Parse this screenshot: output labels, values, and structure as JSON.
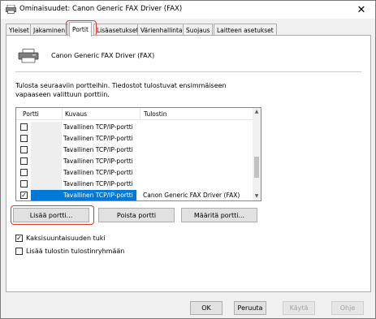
{
  "window": {
    "title": "Ominaisuudet: Canon Generic FAX Driver (FAX)",
    "close_glyph": "✕"
  },
  "tabs": [
    {
      "label": "Yleiset"
    },
    {
      "label": "Jakaminen"
    },
    {
      "label": "Portit",
      "active": true
    },
    {
      "label": "Lisäasetukset"
    },
    {
      "label": "Värienhallinta"
    },
    {
      "label": "Suojaus"
    },
    {
      "label": "Laitteen asetukset"
    }
  ],
  "printer": {
    "name": "Canon Generic FAX Driver (FAX)",
    "icon": "printer-icon"
  },
  "description": "Tulosta seuraaviin portteihin. Tiedostot tulostuvat ensimmäiseen vapaaseen valittuun porttiin.",
  "port_list": {
    "columns": [
      "Portti",
      "Kuvaus",
      "Tulostin"
    ],
    "rows": [
      {
        "checked": false,
        "description": "Tavallinen TCP/IP-portti",
        "printer": "",
        "selected": false
      },
      {
        "checked": false,
        "description": "Tavallinen TCP/IP-portti",
        "printer": "",
        "selected": false
      },
      {
        "checked": false,
        "description": "Tavallinen TCP/IP-portti",
        "printer": "",
        "selected": false
      },
      {
        "checked": false,
        "description": "Tavallinen TCP/IP-portti",
        "printer": "",
        "selected": false
      },
      {
        "checked": false,
        "description": "Tavallinen TCP/IP-portti",
        "printer": "",
        "selected": false
      },
      {
        "checked": false,
        "description": "Tavallinen TCP/IP-portti",
        "printer": "",
        "selected": false
      },
      {
        "checked": true,
        "description": "Tavallinen TCP/IP-portti",
        "printer": "Canon Generic FAX Driver (FAX)",
        "selected": true
      }
    ]
  },
  "port_buttons": {
    "add": "Lisää portti...",
    "delete": "Poista portti",
    "configure": "Määritä portti..."
  },
  "options": {
    "bidirectional": {
      "label": "Kaksisuuntaisuuden tuki",
      "checked": true
    },
    "pooling": {
      "label": "Lisää tulostin tulostinryhmään",
      "checked": false
    }
  },
  "footer": {
    "ok": "OK",
    "cancel": "Peruuta",
    "apply": "Käytä",
    "help": "Ohje"
  },
  "colors": {
    "highlight": "#e0342a",
    "selection": "#0078d7"
  }
}
